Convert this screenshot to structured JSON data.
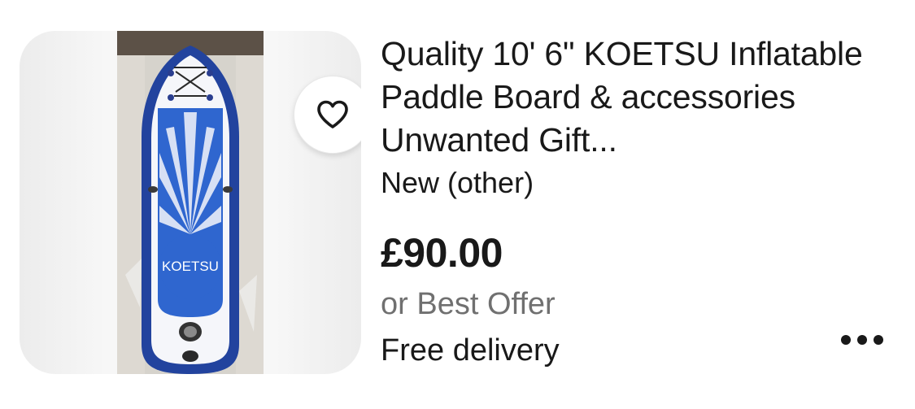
{
  "listing": {
    "title": "Quality 10' 6\" KOETSU Inflatable Paddle Board & accessories Unwanted Gift...",
    "condition": "New (other)",
    "price": "£90.00",
    "offer": "or Best Offer",
    "delivery": "Free delivery",
    "image_brand_text": "KOETSU"
  },
  "icons": {
    "watch": "heart-icon",
    "more": "more-options-icon"
  },
  "colors": {
    "text": "#191919",
    "muted": "#707070",
    "board_blue": "#1f4fb8"
  }
}
